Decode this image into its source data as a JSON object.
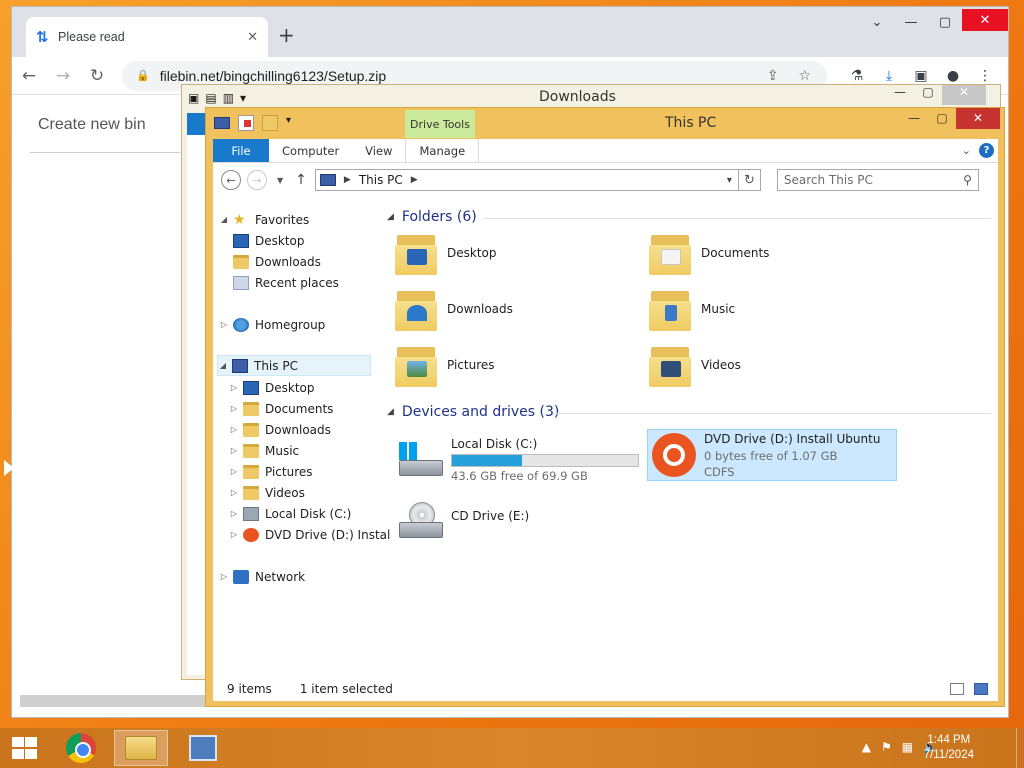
{
  "browser": {
    "tab_title": "Please read",
    "url": "filebin.net/bingchilling6123/Setup.zip",
    "page_heading": "Create new bin"
  },
  "downloads_window": {
    "title": "Downloads"
  },
  "thispc_window": {
    "title": "This PC",
    "contextual_tab": "Drive Tools",
    "ribbon_tabs": {
      "file": "File",
      "computer": "Computer",
      "view": "View",
      "manage": "Manage"
    },
    "address": {
      "location": "This PC"
    },
    "search": {
      "placeholder": "Search This PC"
    },
    "nav": {
      "favorites": "Favorites",
      "fav_desktop": "Desktop",
      "fav_downloads": "Downloads",
      "fav_recent": "Recent places",
      "homegroup": "Homegroup",
      "thispc": "This PC",
      "pc_desktop": "Desktop",
      "pc_documents": "Documents",
      "pc_downloads": "Downloads",
      "pc_music": "Music",
      "pc_pictures": "Pictures",
      "pc_videos": "Videos",
      "pc_c": "Local Disk (C:)",
      "pc_d": "DVD Drive (D:) Instal",
      "network": "Network"
    },
    "folders_header": "Folders (6)",
    "folders": {
      "desktop": "Desktop",
      "documents": "Documents",
      "downloads": "Downloads",
      "music": "Music",
      "pictures": "Pictures",
      "videos": "Videos"
    },
    "devices_header": "Devices and drives (3)",
    "drives": {
      "c_name": "Local Disk (C:)",
      "c_free": "43.6 GB free of 69.9 GB",
      "c_used_fraction": 0.376,
      "d_name": "DVD Drive (D:) Install Ubuntu",
      "d_free": "0 bytes free of 1.07 GB",
      "d_fs": "CDFS",
      "e_name": "CD Drive (E:)"
    },
    "status": {
      "count": "9 items",
      "selection": "1 item selected"
    }
  },
  "taskbar": {
    "time": "1:44 PM",
    "date": "7/11/2024"
  },
  "colors": {
    "accent": "#1979ca",
    "explorer_frame": "#f0c15c",
    "drive_bar": "#26a0da",
    "ubuntu": "#e95420"
  }
}
